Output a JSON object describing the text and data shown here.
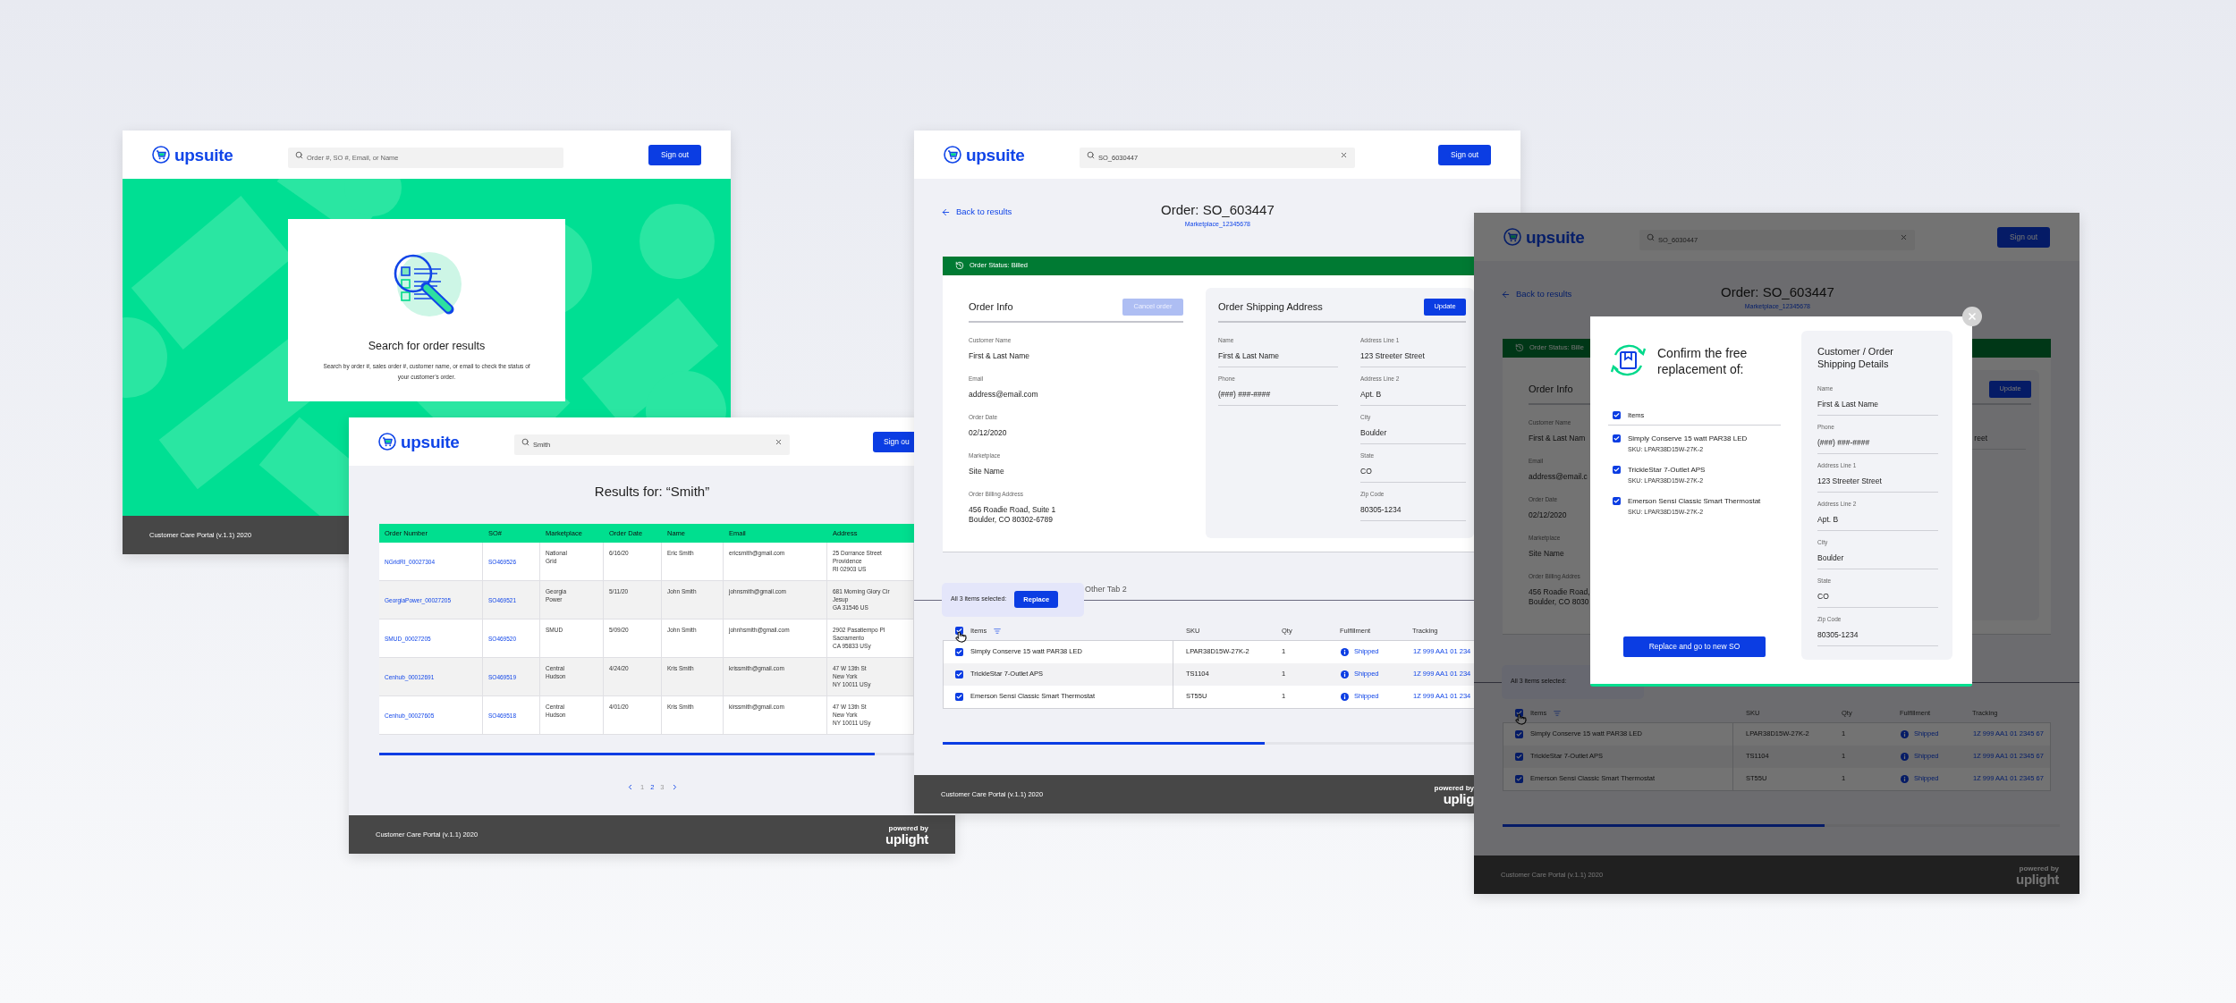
{
  "search_screen": {
    "header": {
      "logo": "upsuite",
      "search": {
        "placeholder": "Order #, SO #, Email, or Name"
      },
      "sign_out": "Sign out"
    },
    "card": {
      "title": "Search for order results",
      "text": "Search by order #, sales order #, customer name, or email to check the status of your customer’s order."
    },
    "footer": {
      "text": "Customer Care Portal (v.1.1) 2020"
    }
  },
  "results_screen": {
    "header": {
      "logo": "upsuite",
      "search": {
        "value": "Smith"
      },
      "sign_out": "Sign ou"
    },
    "title": "Results for: “Smith”",
    "table": {
      "columns": [
        "Order Number",
        "SO#",
        "Marketplace",
        "Order Date",
        "Name",
        "Email",
        "Address"
      ],
      "rows": [
        {
          "order_number": "NGridRI_00027304",
          "so": "SO469526",
          "marketplace": "National\nGrid",
          "order_date": "6/16/20",
          "name": "Eric Smith",
          "email": "ericsmith@gmail.com",
          "address": "25 Dorrance Street\nProvidence\nRI 02903 US"
        },
        {
          "order_number": "GeorgiaPower_00027205",
          "so": "SO469521",
          "marketplace": "Georgia\nPower",
          "order_date": "5/11/20",
          "name": "John Smith",
          "email": "johnsmith@gmail.com",
          "address": "681 Morning Glory Cir\nJesup\nGA 31546 US"
        },
        {
          "order_number": "SMUD_00027205",
          "so": "SO469520",
          "marketplace": "SMUD",
          "order_date": "5/09/20",
          "name": "John Smith",
          "email": "johnhsmith@gmail.com",
          "address": "2902 Pasatiempo Pl\nSacramento\nCA 95833 USy"
        },
        {
          "order_number": "Cenhub_00012691",
          "so": "SO469519",
          "marketplace": "Central\nHudson",
          "order_date": "4/24/20",
          "name": "Kris Smith",
          "email": "krissmith@gmail.com",
          "address": "47 W 13th St\nNew York\nNY 10011 USy"
        },
        {
          "order_number": "Cenhub_00027605",
          "so": "SO469518",
          "marketplace": "Central\nHudson",
          "order_date": "4/01/20",
          "name": "Kris Smith",
          "email": "kirssmith@gmail.com",
          "address": "47 W 13th St\nNew York\nNY 10011 USy"
        }
      ]
    },
    "pagination": [
      {
        "label": "1",
        "selected": false
      },
      {
        "label": "2",
        "selected": true
      },
      {
        "label": "3",
        "selected": false
      }
    ],
    "footer": {
      "text": "Customer Care Portal (v.1.1) 2020",
      "powered_by": "powered by",
      "brand": "uplight"
    }
  },
  "order_screen": {
    "header": {
      "logo": "upsuite",
      "search": {
        "value": "SO_6030447"
      },
      "sign_out": "Sign out"
    },
    "back": "Back to results",
    "title": "Order: SO_603447",
    "marketplace": "Marketplace_12345678",
    "status": "Order Status: Billed",
    "order_info": {
      "title": "Order Info",
      "cancel": {
        "label": "Cancel order",
        "disabled": true
      },
      "fields": [
        {
          "label": "Customer Name",
          "value": "First & Last Name"
        },
        {
          "label": "Email",
          "value": "address@email.com"
        },
        {
          "label": "Order Date",
          "value": "02/12/2020"
        },
        {
          "label": "Marketplace",
          "value": "Site Name"
        },
        {
          "label": "Order Billing Address",
          "value": "456 Roadie Road, Suite 1\nBoulder, CO 80302-6789"
        }
      ]
    },
    "shipping": {
      "title": "Order Shipping Address",
      "update": "Update",
      "fields_left": [
        {
          "label": "Name",
          "value": "First & Last Name"
        },
        {
          "label": "Phone",
          "value": "(###) ###-####"
        }
      ],
      "fields_right": [
        {
          "label": "Address Line 1",
          "value": "123 Streeter Street"
        },
        {
          "label": "Address Line 2",
          "value": "Apt. B"
        },
        {
          "label": "City",
          "value": "Boulder"
        },
        {
          "label": "State",
          "value": "CO"
        },
        {
          "label": "Zip Code",
          "value": "80305-1234"
        }
      ]
    },
    "tab": "Other Tab 2",
    "popover": {
      "text": "All 3 items selected:",
      "button": "Replace"
    },
    "table": {
      "columns": [
        "Items",
        "SKU",
        "Qty",
        "Fulfillment",
        "Tracking"
      ],
      "header_checked": true,
      "rows": [
        {
          "checked": true,
          "item": "Simply Conserve 15 watt PAR38 LED",
          "sku": "LPAR38D15W-27K-2",
          "qty": "1",
          "status": "Shipped",
          "tracking": "1Z 999 AA1 01 234"
        },
        {
          "checked": true,
          "item": "TrickleStar 7-Outlet APS",
          "sku": "TS1104",
          "qty": "1",
          "status": "Shipped",
          "tracking": "1Z 999 AA1 01 234"
        },
        {
          "checked": true,
          "item": "Emerson Sensi Classic Smart Thermostat",
          "sku": "ST55U",
          "qty": "1",
          "status": "Shipped",
          "tracking": "1Z 999 AA1 01 234"
        }
      ]
    },
    "footer": {
      "text": "Customer Care Portal (v.1.1) 2020",
      "powered_by": "powered by",
      "brand": "uplig"
    }
  },
  "replacement_screen": {
    "page": {
      "header": {
        "logo": "upsuite",
        "search": {
          "value": "SO_6030447"
        },
        "sign_out": "Sign out"
      },
      "back": "Back to results",
      "title": "Order: SO_603447",
      "marketplace": "Marketplace_12345678",
      "status": "Order Status: Bille",
      "order_info": {
        "title": "Order Info",
        "fields": [
          {
            "label": "Customer Name",
            "value": "First & Last Nam"
          },
          {
            "label": "Email",
            "value": "address@email.c"
          },
          {
            "label": "Order Date",
            "value": "02/12/2020"
          },
          {
            "label": "Marketplace",
            "value": "Site Name"
          },
          {
            "label": "Order Billing Addres",
            "value": "456 Roadie Road,\nBoulder, CO 8030"
          }
        ]
      },
      "shipping": {
        "update": "Update",
        "fields_right": [
          {
            "value": "reet"
          }
        ]
      },
      "popover": {
        "text": "All 3 items selected:"
      },
      "table": {
        "columns": [
          "Items",
          "SKU",
          "Qty",
          "Fulfillment",
          "Tracking"
        ],
        "header_checked": true,
        "rows": [
          {
            "checked": true,
            "item": "Simply Conserve 15 watt PAR38 LED",
            "sku": "LPAR38D15W-27K-2",
            "qty": "1",
            "status": "Shipped",
            "tracking": "1Z 999 AA1 01 2345 67"
          },
          {
            "checked": true,
            "item": "TrickleStar 7-Outlet APS",
            "sku": "TS1104",
            "qty": "1",
            "status": "Shipped",
            "tracking": "1Z 999 AA1 01 2345 67"
          },
          {
            "checked": true,
            "item": "Emerson Sensi Classic Smart Thermostat",
            "sku": "ST55U",
            "qty": "1",
            "status": "Shipped",
            "tracking": "1Z 999 AA1 01 2345 67"
          }
        ]
      },
      "footer": {
        "text": "Customer Care Portal (v.1.1) 2020",
        "powered_by": "powered by",
        "brand": "uplight"
      }
    },
    "modal": {
      "title": "Confirm the free replacement of:",
      "items_header": {
        "label": "Items",
        "checked": true
      },
      "items": [
        {
          "checked": true,
          "name": "Simply Conserve 15 watt PAR38 LED",
          "sku": "SKU: LPAR38D15W-27K-2"
        },
        {
          "checked": true,
          "name": "TrickleStar 7-Outlet APS",
          "sku": "SKU: LPAR38D15W-27K-2"
        },
        {
          "checked": true,
          "name": "Emerson Sensi Classic Smart Thermostat",
          "sku": "SKU: LPAR38D15W-27K-2"
        }
      ],
      "button": "Replace and go to new SO",
      "details": {
        "title": "Customer / Order Shipping Details",
        "fields": [
          {
            "label": "Name",
            "value": "First & Last Name"
          },
          {
            "label": "Phone",
            "value": "(###) ###-####"
          },
          {
            "label": "Address Line 1",
            "value": "123 Streeter Street"
          },
          {
            "label": "Address Line 2",
            "value": "Apt. B"
          },
          {
            "label": "City",
            "value": "Boulder"
          },
          {
            "label": "State",
            "value": "CO"
          },
          {
            "label": "Zip Code",
            "value": "80305-1234"
          }
        ]
      }
    }
  }
}
